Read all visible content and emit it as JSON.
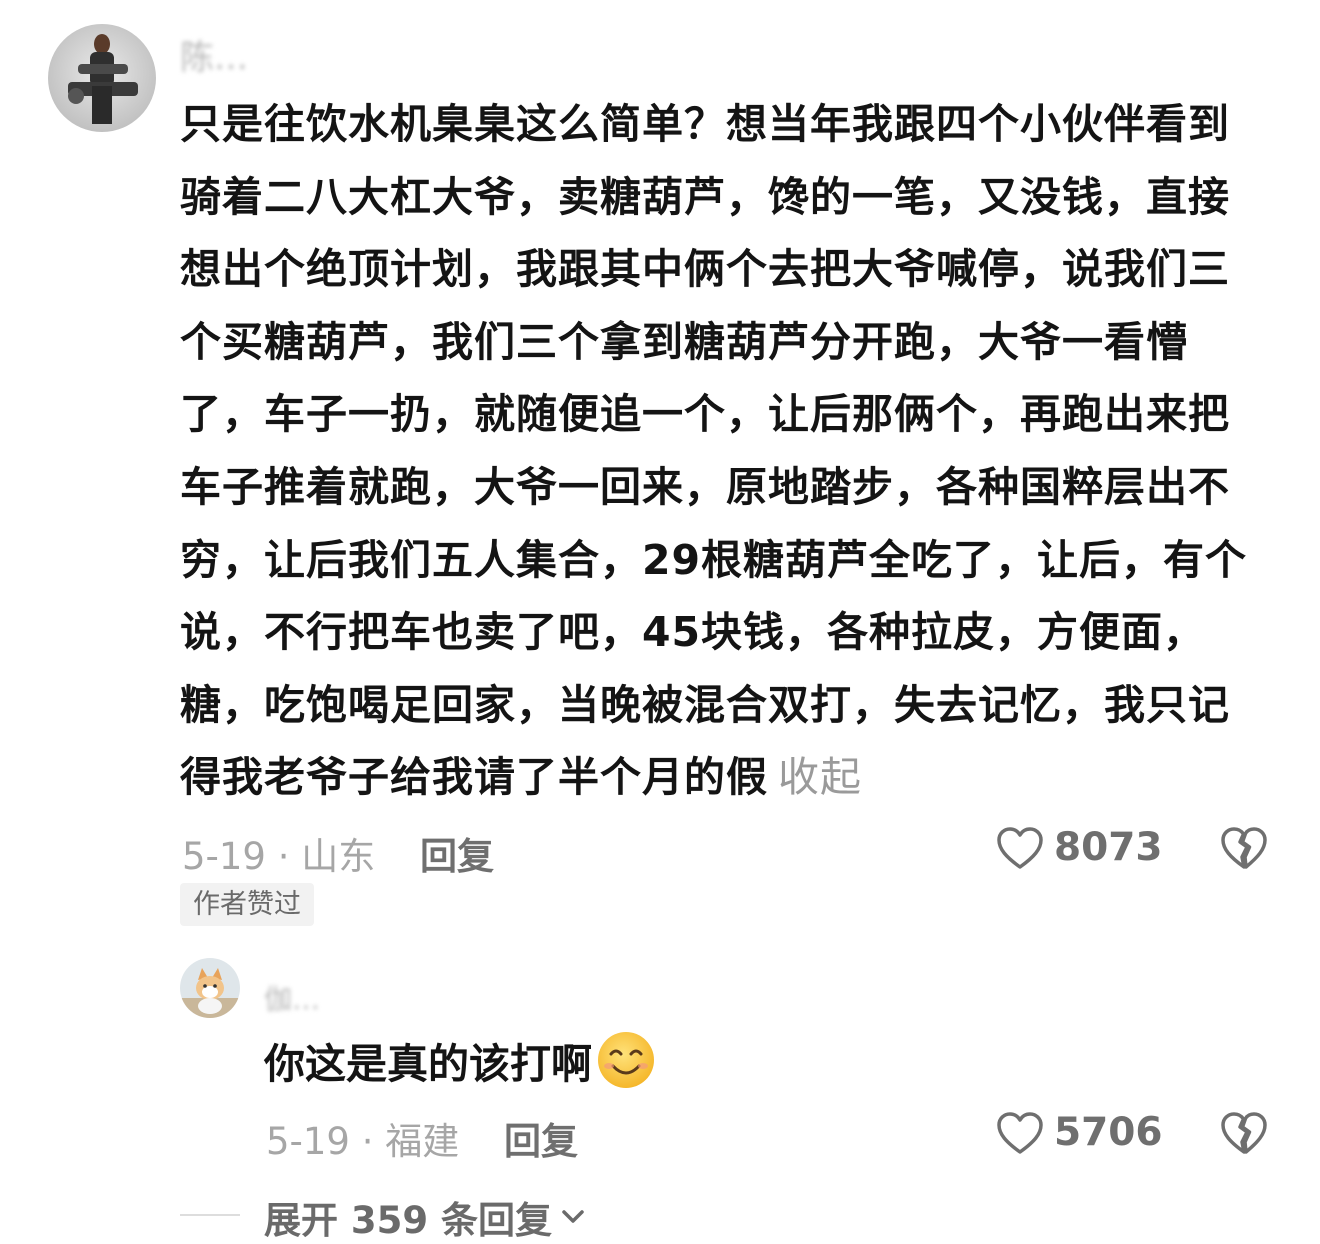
{
  "main_comment": {
    "username": "陈…",
    "text": "只是往饮水机臬臬这么简单？想当年我跟四个小伙伴看到骑着二八大杠大爷，卖糖葫芦，馋的一笔，又没钱，直接想出个绝顶计划，我跟其中俩个去把大爷喊停，说我们三个买糖葫芦，我们三个拿到糖葫芦分开跑，大爷一看懵了，车子一扔，就随便追一个，让后那俩个，再跑出来把车子推着就跑，大爷一回来，原地踏步，各种国粹层出不穷，让后我们五人集合，29根糖葫芦全吃了，让后，有个说，不行把车也卖了吧，45块钱，各种拉皮，方便面，糖，吃饱喝足回家，当晚被混合双打，失去记忆，我只记得我老爷子给我请了半个月的假",
    "collapse_label": "收起",
    "date_location": "5-19 · 山东",
    "reply_label": "回复",
    "like_count": "8073",
    "badge": "作者赞过",
    "avatar_icon": "user-avatar-man-with-gun",
    "like_icon": "heart-outline-icon",
    "dislike_icon": "broken-heart-icon"
  },
  "reply": {
    "username": "伽…",
    "text": "你这是真的该打啊",
    "emoji_icon": "smiling-face-emoji",
    "date_location": "5-19 · 福建",
    "reply_label": "回复",
    "like_count": "5706",
    "avatar_icon": "user-avatar-cat"
  },
  "expand_replies": {
    "label": "展开 359 条回复",
    "chevron_icon": "chevron-down-icon"
  },
  "colors": {
    "text": "#141414",
    "meta": "#a6a6a6",
    "secondary": "#6f6f6f",
    "badge_bg": "#f2f2f2"
  }
}
